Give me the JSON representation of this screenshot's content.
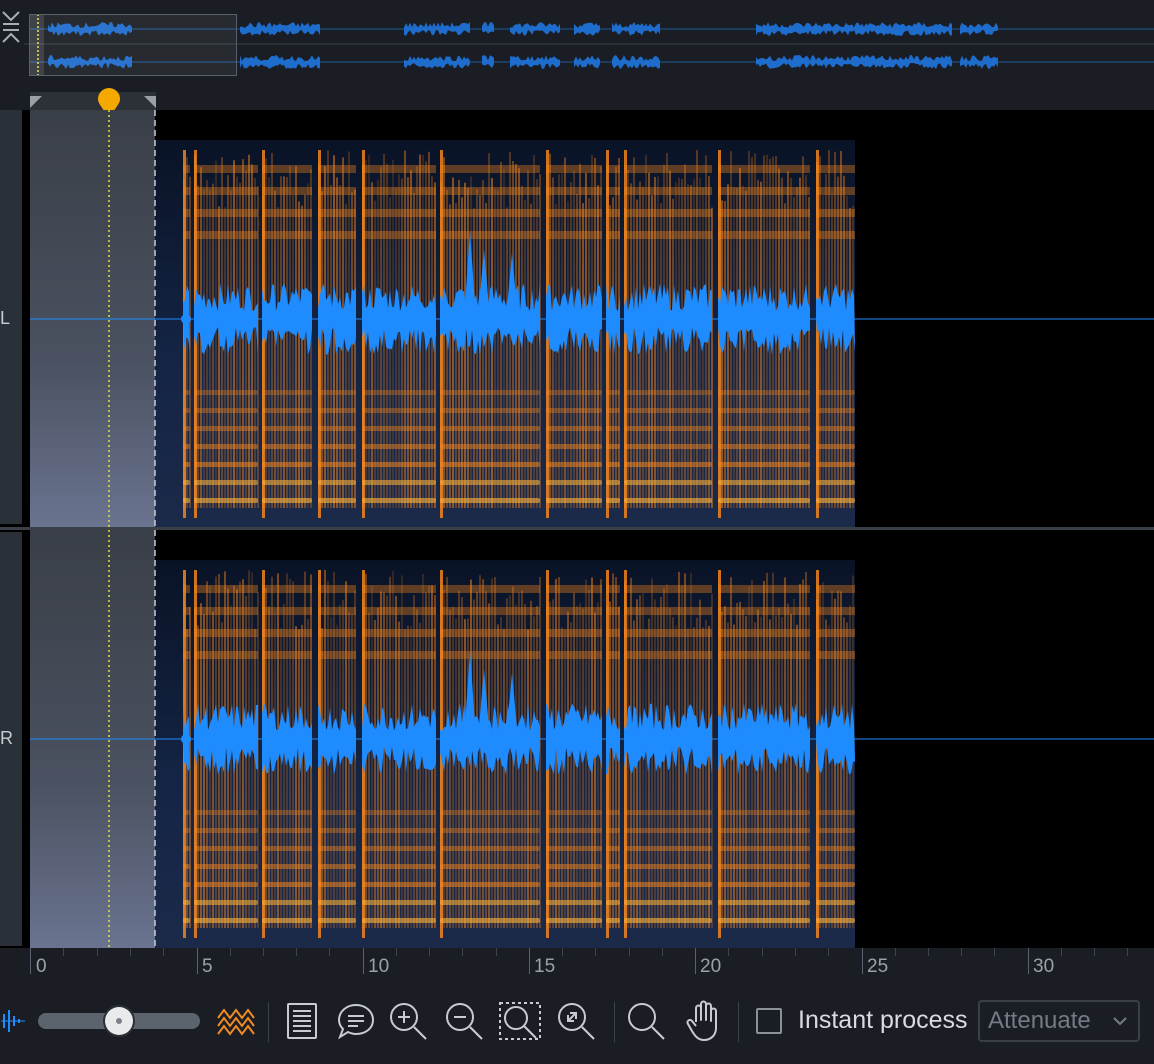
{
  "colors": {
    "background": "#1a1e24",
    "waveform": "#1e8cff",
    "spectrogram_hot": "#ff8a1a",
    "playhead": "#f5a800",
    "accent_orange": "#f08a24"
  },
  "channels": [
    {
      "label": "L"
    },
    {
      "label": "R"
    }
  ],
  "ruler": {
    "labels": [
      "0",
      "5",
      "10",
      "15",
      "20",
      "25",
      "30"
    ]
  },
  "toolbar": {
    "instant_process_label": "Instant process",
    "mode_value": "Attenuate",
    "zoom_slider_level": 0.5,
    "icons": [
      "waveform-toggle-icon",
      "zoom-slider",
      "spectrogram-toggle-icon",
      "file-list-icon",
      "comment-icon",
      "zoom-in-icon",
      "zoom-out-icon",
      "zoom-selection-icon",
      "zoom-fit-icon",
      "magnify-icon",
      "hand-icon"
    ]
  }
}
